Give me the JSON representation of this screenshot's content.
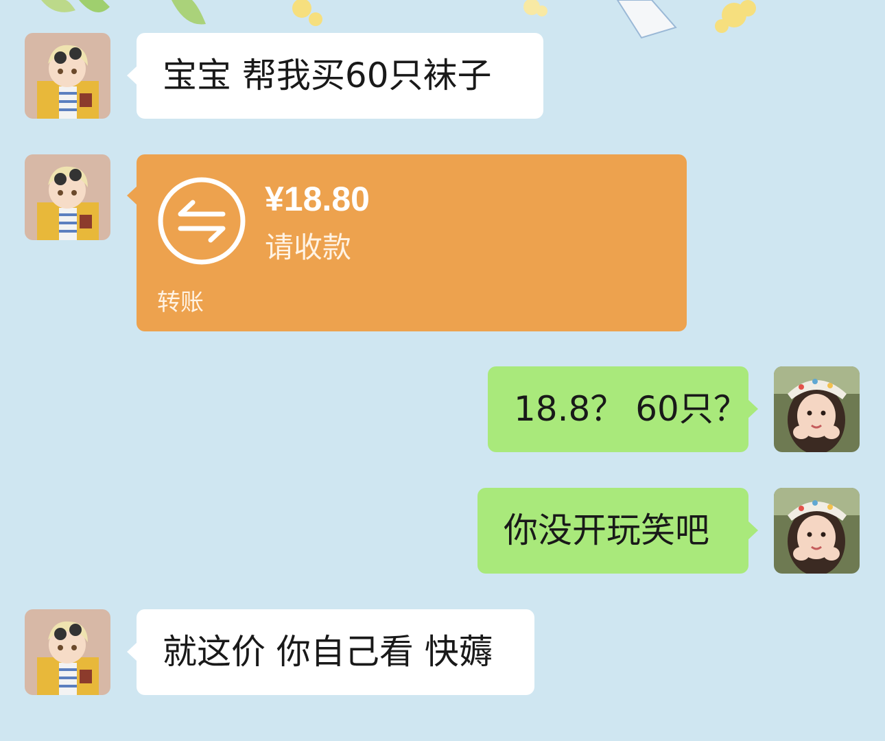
{
  "chat": {
    "messages": [
      {
        "side": "left",
        "type": "text",
        "text": "宝宝 帮我买60只袜子"
      },
      {
        "side": "left",
        "type": "transfer",
        "amount": "¥18.80",
        "status": "请收款",
        "label": "转账"
      },
      {
        "side": "right",
        "type": "text",
        "text": "18.8？ 60只？"
      },
      {
        "side": "right",
        "type": "text",
        "text": "你没开玩笑吧"
      },
      {
        "side": "left",
        "type": "text",
        "text": "就这价 你自己看 快薅"
      }
    ]
  },
  "colors": {
    "background": "#cfe6f1",
    "bubble_incoming": "#ffffff",
    "bubble_outgoing": "#a9e97b",
    "transfer_card": "#eda24e"
  },
  "icons": {
    "transfer": "transfer-arrows-icon"
  }
}
